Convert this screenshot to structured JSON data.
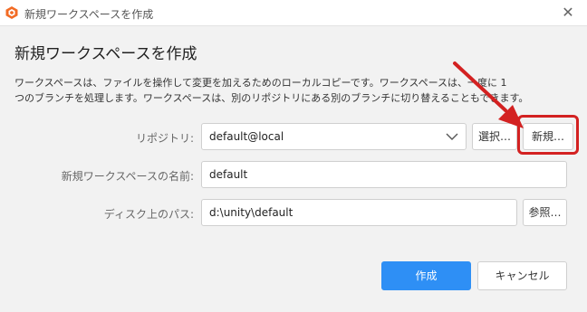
{
  "window": {
    "title": "新規ワークスペースを作成",
    "app_icon": "plastic-scm-icon",
    "close_icon": "close-icon",
    "close_glyph": "✕"
  },
  "dialog": {
    "heading": "新規ワークスペースを作成",
    "description_line1": "ワークスペースは、ファイルを操作して変更を加えるためのローカルコピーです。ワークスペースは、一度に 1",
    "description_line2": "つのブランチを処理します。ワークスペースは、別のリポジトリにある別のブランチに切り替えることもできます。"
  },
  "form": {
    "repository": {
      "label": "リポジトリ:",
      "value": "default@local",
      "select_button": "選択…",
      "new_button": "新規…"
    },
    "workspace_name": {
      "label": "新規ワークスペースの名前:",
      "value": "default"
    },
    "disk_path": {
      "label": "ディスク上のパス:",
      "value": "d:\\unity\\default",
      "browse_button": "参照…"
    }
  },
  "actions": {
    "create": "作成",
    "cancel": "キャンセル"
  },
  "annotation": {
    "color": "#d32121"
  },
  "colors": {
    "primary": "#2e8ff5",
    "annotation_red": "#d32121"
  }
}
